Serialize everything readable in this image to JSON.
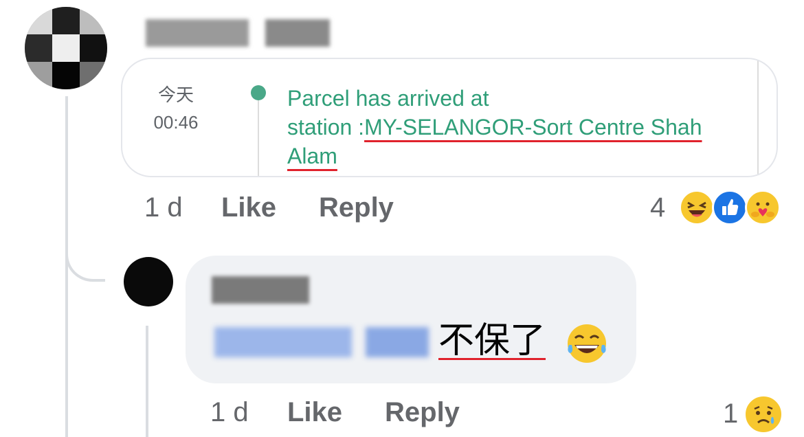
{
  "comment": {
    "shared_card": {
      "date": "今天",
      "time": "00:46",
      "status_line1": "Parcel has arrived at",
      "status_prefix": "station :",
      "status_location_part1": "MY-SELANGOR-Sort Centre Shah",
      "status_location_part2": "Alam"
    },
    "actions": {
      "time": "1 d",
      "like": "Like",
      "reply": "Reply"
    },
    "reaction_count": "4",
    "reactions": [
      "laughing-emoji-icon",
      "like-reaction-icon",
      "care-reaction-icon"
    ]
  },
  "reply": {
    "text": "不保了",
    "emoji": "tears-of-joy-emoji-icon",
    "actions": {
      "time": "1 d",
      "like": "Like",
      "reply": "Reply"
    },
    "reaction_count": "1",
    "reactions": [
      "sad-reaction-icon"
    ]
  },
  "colors": {
    "link_text": "#2f9e78",
    "underline_red": "#e0222c",
    "bubble_bg": "#f0f2f5",
    "meta_text": "#65676b"
  }
}
